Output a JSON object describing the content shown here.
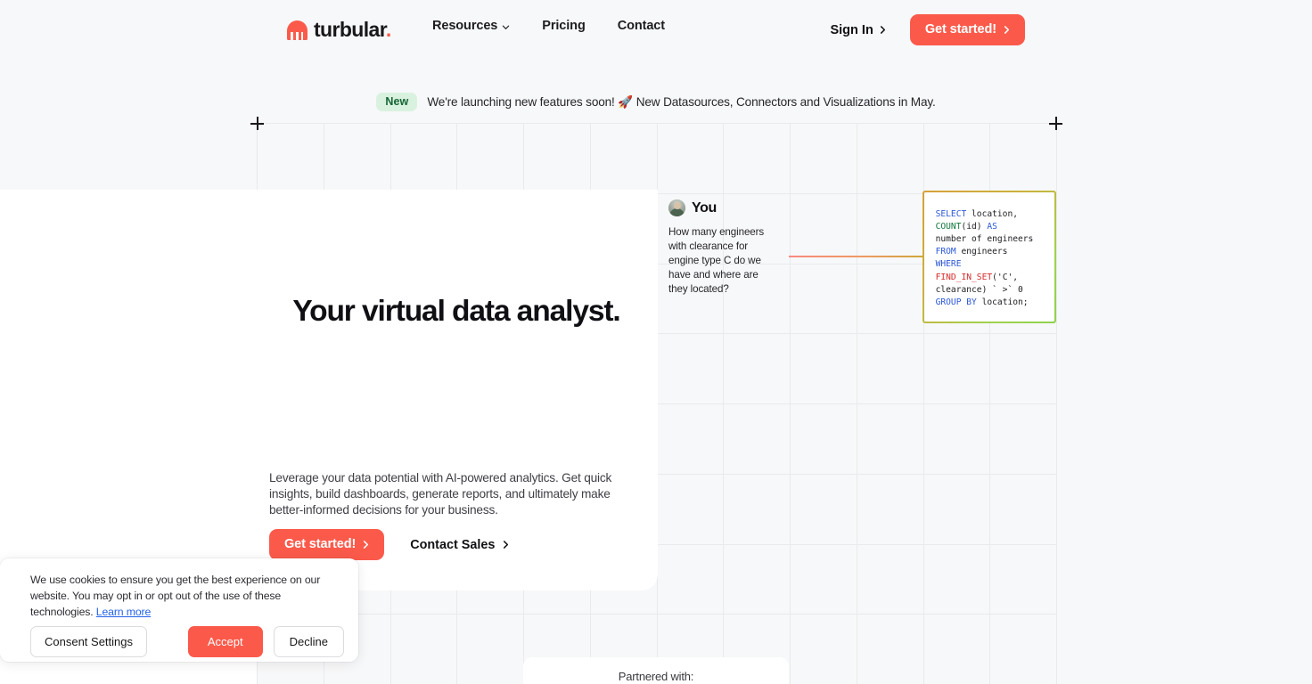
{
  "header": {
    "logo": {
      "text": "turbular",
      "dot": ".",
      "icon": "turbular-logo-icon"
    },
    "nav": [
      {
        "label": "Resources",
        "has_caret": true
      },
      {
        "label": "Pricing",
        "has_caret": false
      },
      {
        "label": "Contact",
        "has_caret": false
      }
    ],
    "sign_in": "Sign In",
    "get_started": "Get started!"
  },
  "announcement": {
    "badge": "New",
    "text": "We're launching new features soon! 🚀 New Datasources, Connectors and Visualizations in May."
  },
  "hero": {
    "title": "Your virtual data analyst.",
    "subtitle": "Leverage your data potential with AI-powered analytics. Get quick insights, build dashboards, generate reports, and ultimately make better-informed decisions for your business.",
    "cta_primary": "Get started!",
    "cta_secondary": "Contact Sales"
  },
  "chat": {
    "author": "You",
    "message": "How many engineers with clearance for engine type C do we have and where are they located?"
  },
  "sql": {
    "tokens": [
      {
        "t": "SELECT",
        "c": "blue"
      },
      {
        "t": " location,\n",
        "c": "plain"
      },
      {
        "t": "COUNT",
        "c": "green"
      },
      {
        "t": "(id) ",
        "c": "plain"
      },
      {
        "t": "AS",
        "c": "blue"
      },
      {
        "t": "\nnumber of engineers\n",
        "c": "plain"
      },
      {
        "t": "FROM",
        "c": "blue"
      },
      {
        "t": " engineers\n",
        "c": "plain"
      },
      {
        "t": "WHERE",
        "c": "blue"
      },
      {
        "t": "\n",
        "c": "plain"
      },
      {
        "t": "FIND_IN_SET",
        "c": "red"
      },
      {
        "t": "('C', clearance) ` >` 0\n",
        "c": "plain"
      },
      {
        "t": "GROUP BY",
        "c": "blue"
      },
      {
        "t": " location;",
        "c": "plain"
      }
    ],
    "plain_text": "SELECT location, COUNT(id) AS number of engineers FROM engineers WHERE FIND_IN_SET('C', clearance) ` >` 0 GROUP BY location;"
  },
  "partners": {
    "label": "Partnered with:"
  },
  "cookie": {
    "text_before_link": "We use cookies to ensure you get the best experience on our website. You may opt in or opt out of the use of these technologies. ",
    "link": "Learn more",
    "consent_settings": "Consent Settings",
    "accept": "Accept",
    "decline": "Decline"
  },
  "colors": {
    "accent": "#fb5a4b",
    "background": "#f7f8f9",
    "grid_line": "#e9eaec",
    "badge_bg": "#d9f2e0",
    "badge_text": "#166534",
    "link": "#2563eb",
    "sql_keyword": "#2c58d9",
    "sql_function_green": "#117a3c",
    "sql_function_red": "#d62a2a"
  }
}
